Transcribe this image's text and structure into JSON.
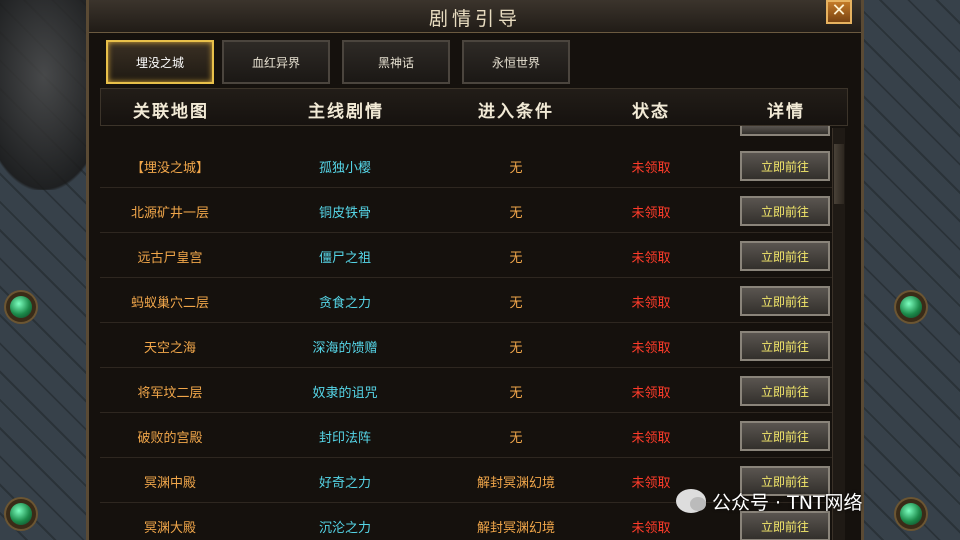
{
  "window": {
    "title": "剧情引导",
    "close_glyph": "✕"
  },
  "tabs": [
    {
      "label": "埋没之城",
      "active": true
    },
    {
      "label": "血红异界",
      "active": false
    },
    {
      "label": "黑神话",
      "active": false
    },
    {
      "label": "永恒世界",
      "active": false
    }
  ],
  "columns": {
    "map": "关联地图",
    "story": "主线剧情",
    "condition": "进入条件",
    "status": "状态",
    "detail": "详情"
  },
  "rows": [
    {
      "map": "【埋没之城】",
      "story": "孤独小樱",
      "condition": "无",
      "status": "未领取",
      "button": "立即前往"
    },
    {
      "map": "北源矿井一层",
      "story": "铜皮铁骨",
      "condition": "无",
      "status": "未领取",
      "button": "立即前往"
    },
    {
      "map": "远古尸皇宫",
      "story": "僵尸之祖",
      "condition": "无",
      "status": "未领取",
      "button": "立即前往"
    },
    {
      "map": "蚂蚁巢穴二层",
      "story": "贪食之力",
      "condition": "无",
      "status": "未领取",
      "button": "立即前往"
    },
    {
      "map": "天空之海",
      "story": "深海的馈赠",
      "condition": "无",
      "status": "未领取",
      "button": "立即前往"
    },
    {
      "map": "将军坟二层",
      "story": "奴隶的诅咒",
      "condition": "无",
      "status": "未领取",
      "button": "立即前往"
    },
    {
      "map": "破败的宫殿",
      "story": "封印法阵",
      "condition": "无",
      "status": "未领取",
      "button": "立即前往"
    },
    {
      "map": "冥渊中殿",
      "story": "好奇之力",
      "condition": "解封冥渊幻境",
      "status": "未领取",
      "button": "立即前往"
    },
    {
      "map": "冥渊大殿",
      "story": "沉沦之力",
      "condition": "解封冥渊幻境",
      "status": "未领取",
      "button": "立即前往"
    }
  ],
  "watermark": {
    "text": "公众号 · TNT网络"
  },
  "colors": {
    "map_text": "#f0a64a",
    "story_text": "#56d6e8",
    "status_text": "#ff3c2a",
    "button_text": "#f4e86a",
    "active_tab_border": "#e8c04a"
  },
  "icons": {
    "close": "close-icon",
    "watermark": "wechat-icon"
  }
}
